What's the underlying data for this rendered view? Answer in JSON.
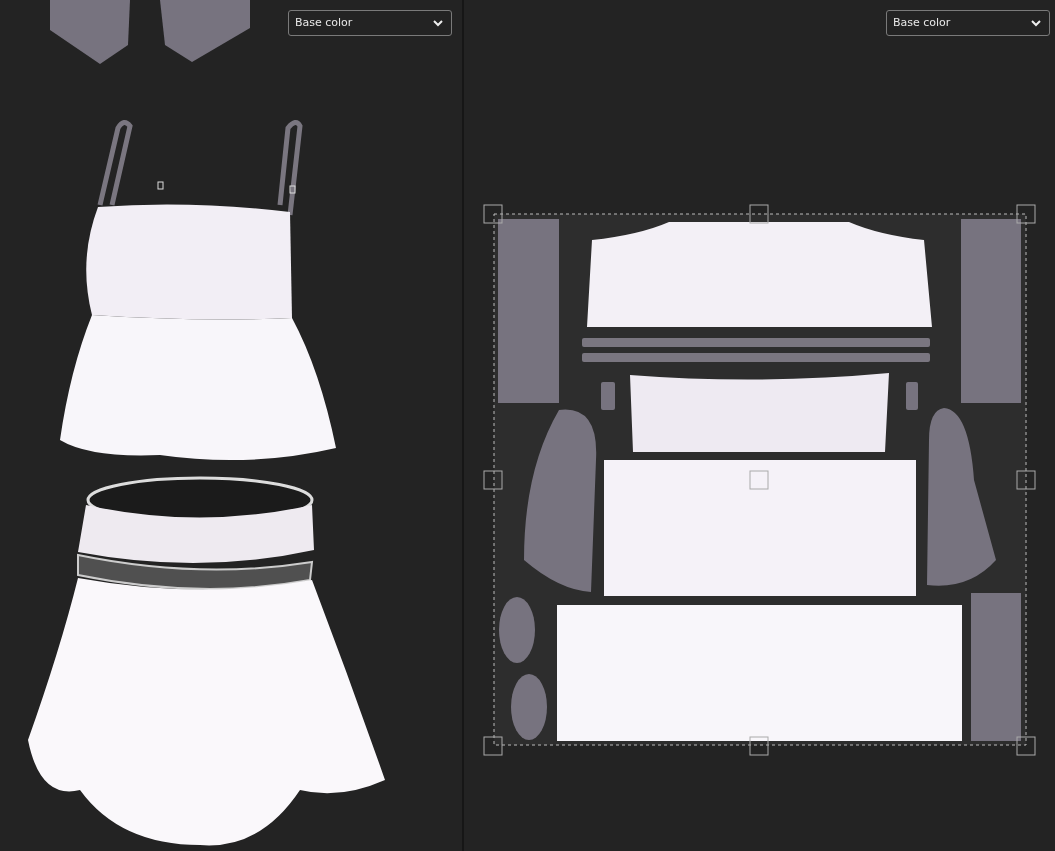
{
  "viewports": [
    {
      "kind": "model",
      "channel_dropdown": {
        "value": "Base color"
      }
    },
    {
      "kind": "uv",
      "channel_dropdown": {
        "value": "Base color"
      }
    }
  ]
}
